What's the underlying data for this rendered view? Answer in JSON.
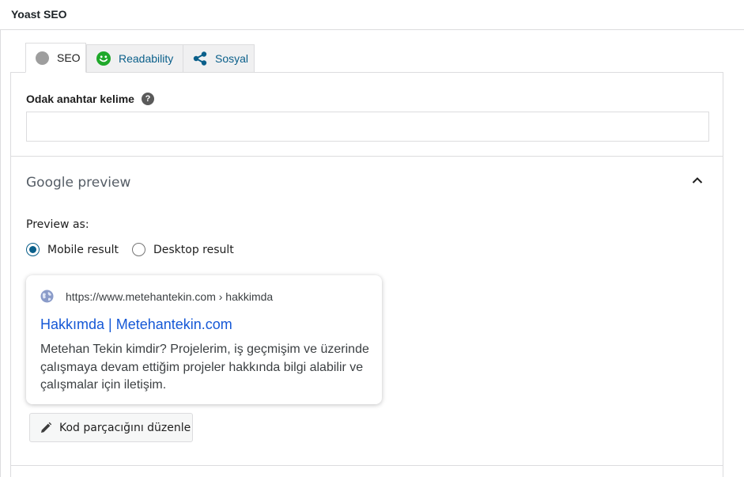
{
  "header": {
    "title": "Yoast SEO"
  },
  "tabs": [
    {
      "label": "SEO",
      "icon": "grey-dot-icon",
      "active": true
    },
    {
      "label": "Readability",
      "icon": "smiley-icon",
      "active": false
    },
    {
      "label": "Sosyal",
      "icon": "share-icon",
      "active": false
    }
  ],
  "focus_keyword": {
    "label": "Odak anahtar kelime",
    "value": "",
    "placeholder": ""
  },
  "google_preview": {
    "title": "Google preview",
    "preview_as_label": "Preview as:",
    "options": [
      "Mobile result",
      "Desktop result"
    ],
    "selected": "Mobile result",
    "result": {
      "url": "https://www.metehantekin.com › hakkimda",
      "title": "Hakkımda | Metehantekin.com",
      "description": "Metehan Tekin kimdir? Projelerim, iş geçmişim ve üzerinde çalışmaya devam ettiğim projeler hakkında bilgi alabilir ve çalışmalar için iletişim."
    },
    "edit_button_label": "Kod parçacığını düzenle"
  },
  "colors": {
    "link_blue": "#1558d6",
    "tab_text": "#0a5f8a",
    "smiley_green": "#1fa82a",
    "seo_dot_grey": "#9e9e9e"
  }
}
